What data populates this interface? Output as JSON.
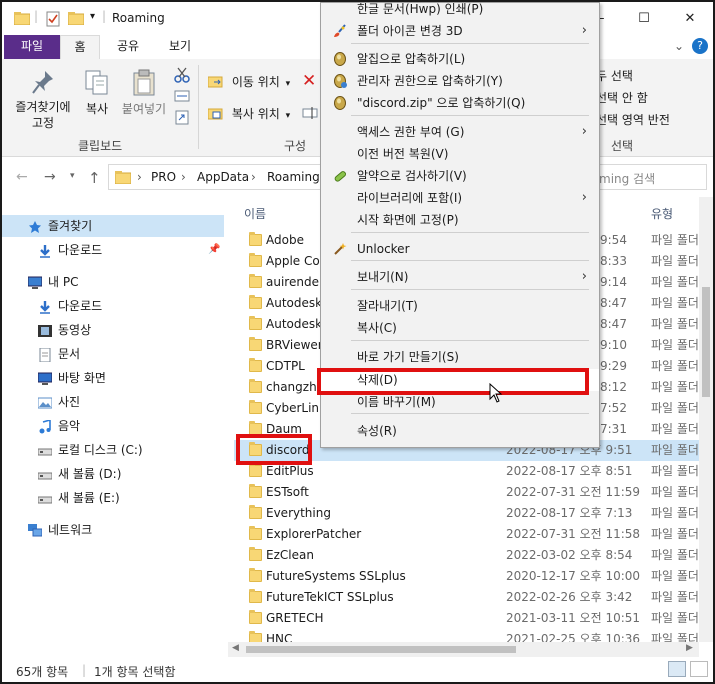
{
  "window": {
    "title": "Roaming",
    "minimize": "—",
    "maximize": "☐",
    "close": "✕"
  },
  "ribbon": {
    "tabs": [
      "파일",
      "홈",
      "공유",
      "보기"
    ],
    "pin_label": "즐겨찾기에\n고정",
    "pin_line1": "즐겨찾기에",
    "pin_line2": "고정",
    "copy_label": "복사",
    "paste_label": "붙여넣기",
    "move_to": "이동 위치",
    "copy_to": "복사 위치",
    "clipboard_group": "클립보드",
    "organize_group": "구성",
    "select_all_partial": "두 선택",
    "select_none_partial": "선택 안 함",
    "invert_partial": "선택 영역 반전",
    "select_group": "선택"
  },
  "address": {
    "crumbs": [
      "PRO",
      "AppData",
      "Roaming"
    ],
    "search_partial": "ming 검색"
  },
  "nav": {
    "items": [
      {
        "label": "즐겨찾기",
        "icon": "star-icon",
        "indent": 0
      },
      {
        "label": "다운로드",
        "icon": "download-arrow-icon",
        "indent": 1
      },
      {
        "label": "내 PC",
        "icon": "pc-icon",
        "indent": 0
      },
      {
        "label": "다운로드",
        "icon": "download-arrow-icon",
        "indent": 1
      },
      {
        "label": "동영상",
        "icon": "video-icon",
        "indent": 1
      },
      {
        "label": "문서",
        "icon": "document-icon",
        "indent": 1
      },
      {
        "label": "바탕 화면",
        "icon": "desktop-icon",
        "indent": 1
      },
      {
        "label": "사진",
        "icon": "picture-icon",
        "indent": 1
      },
      {
        "label": "음악",
        "icon": "music-note-icon",
        "indent": 1
      },
      {
        "label": "로컬 디스크 (C:)",
        "icon": "drive-icon",
        "indent": 1
      },
      {
        "label": "새 볼륨 (D:)",
        "icon": "drive-icon",
        "indent": 1
      },
      {
        "label": "새 볼륨 (E:)",
        "icon": "drive-icon",
        "indent": 1
      },
      {
        "label": "네트워크",
        "icon": "network-icon",
        "indent": 0
      }
    ]
  },
  "files": {
    "col_name": "이름",
    "col_type": "유형",
    "rows": [
      {
        "name": "Adobe",
        "date": "9:54",
        "type": "파일 폴더"
      },
      {
        "name": "Apple Com",
        "date": "8:33",
        "type": "파일 폴더"
      },
      {
        "name": "auirender",
        "date": "9:14",
        "type": "파일 폴더"
      },
      {
        "name": "Autodesk",
        "date": "8:47",
        "type": "파일 폴더"
      },
      {
        "name": "Autodesk",
        "date": "8:47",
        "type": "파일 폴더"
      },
      {
        "name": "BRViewer_",
        "date": "9:10",
        "type": "파일 폴더"
      },
      {
        "name": "CDTPL",
        "date": "9:29",
        "type": "파일 폴더"
      },
      {
        "name": "changzhi",
        "date": "8:12",
        "type": "파일 폴더"
      },
      {
        "name": "CyberLink",
        "date": "7:52",
        "type": "파일 폴더"
      },
      {
        "name": "Daum",
        "date": "7:31",
        "type": "파일 폴더"
      },
      {
        "name": "discord",
        "date": "2022-08-17 오후 9:51",
        "type": "파일 폴더"
      },
      {
        "name": "EditPlus",
        "date": "2022-08-17 오후 8:51",
        "type": "파일 폴더"
      },
      {
        "name": "ESTsoft",
        "date": "2022-07-31 오전 11:59",
        "type": "파일 폴더"
      },
      {
        "name": "Everything",
        "date": "2022-08-17 오후 7:13",
        "type": "파일 폴더"
      },
      {
        "name": "ExplorerPatcher",
        "date": "2022-07-31 오전 11:58",
        "type": "파일 폴더"
      },
      {
        "name": "EzClean",
        "date": "2022-03-02 오후 8:54",
        "type": "파일 폴더"
      },
      {
        "name": "FutureSystems SSLplus",
        "date": "2020-12-17 오후 10:00",
        "type": "파일 폴더"
      },
      {
        "name": "FutureTekICT SSLplus",
        "date": "2022-02-26 오후 3:42",
        "type": "파일 폴더"
      },
      {
        "name": "GRETECH",
        "date": "2021-03-11 오전 10:51",
        "type": "파일 폴더"
      },
      {
        "name": "HNC",
        "date": "2021-02-25 오후 10:36",
        "type": "파일 폴더"
      }
    ]
  },
  "status": {
    "count": "65개 항목",
    "selected": "1개 항목 선택함"
  },
  "context_menu": {
    "items": [
      {
        "label": "한글 문서(Hwp) 인쇄(P)",
        "icon": "",
        "submenu": false
      },
      {
        "label": "폴더 아이콘 변경 3D",
        "icon": "brush-icon",
        "submenu": true
      },
      {
        "label": "알집으로 압축하기(L)",
        "icon": "alzip-icon",
        "submenu": false
      },
      {
        "label": "관리자 권한으로 압축하기(Y)",
        "icon": "alzip-admin-icon",
        "submenu": false
      },
      {
        "label": "\"discord.zip\" 으로 압축하기(Q)",
        "icon": "alzip-icon",
        "submenu": false
      },
      {
        "label": "액세스 권한 부여 (G)",
        "icon": "",
        "submenu": true
      },
      {
        "label": "이전 버전 복원(V)",
        "icon": "",
        "submenu": false
      },
      {
        "label": "알약으로 검사하기(V)",
        "icon": "alyac-icon",
        "submenu": false
      },
      {
        "label": "라이브러리에 포함(I)",
        "icon": "",
        "submenu": true
      },
      {
        "label": "시작 화면에 고정(P)",
        "icon": "",
        "submenu": false
      },
      {
        "label": "Unlocker",
        "icon": "unlocker-wand-icon",
        "submenu": false
      },
      {
        "label": "보내기(N)",
        "icon": "",
        "submenu": true
      },
      {
        "label": "잘라내기(T)",
        "icon": "",
        "submenu": false
      },
      {
        "label": "복사(C)",
        "icon": "",
        "submenu": false
      },
      {
        "label": "바로 가기 만들기(S)",
        "icon": "",
        "submenu": false
      },
      {
        "label": "삭제(D)",
        "icon": "",
        "submenu": false
      },
      {
        "label": "이름 바꾸기(M)",
        "icon": "",
        "submenu": false
      },
      {
        "label": "속성(R)",
        "icon": "",
        "submenu": false
      }
    ]
  },
  "colors": {
    "file_tab": "#5a2d8a",
    "selection": "#cce4f7",
    "highlight_box": "#e01010",
    "folder": "#f8d775"
  }
}
